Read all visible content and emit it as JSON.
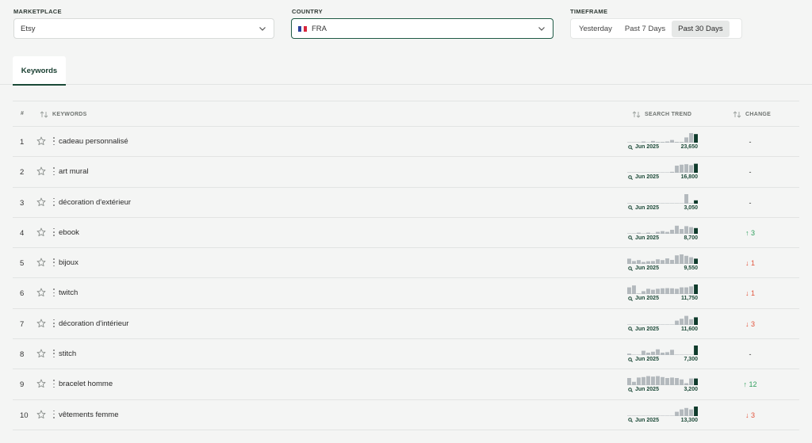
{
  "filters": {
    "marketplace_label": "MARKETPLACE",
    "marketplace_value": "Etsy",
    "country_label": "COUNTRY",
    "country_value": "FRA",
    "country_flag_colors": [
      "#2a3f9c",
      "#ffffff",
      "#d7263d"
    ],
    "timeframe_label": "TIMEFRAME",
    "timeframe_options": [
      "Yesterday",
      "Past 7 Days",
      "Past 30 Days"
    ],
    "timeframe_selected": "Past 30 Days"
  },
  "tabs": {
    "keywords": "Keywords"
  },
  "table": {
    "headers": {
      "num": "#",
      "keywords": "KEYWORDS",
      "search_trend": "SEARCH TREND",
      "change": "CHANGE"
    },
    "trend_month": "Jun 2025",
    "colors": {
      "bar": "#b3b9bd",
      "bar_last": "#0f3b2c",
      "baseline": "#c5c9cc"
    },
    "rows": [
      {
        "num": "1",
        "keyword": "cadeau personnalisé",
        "volume": "23,650",
        "change": "-",
        "direction": "none",
        "trend": [
          0.04,
          0.04,
          0.04,
          0.12,
          0.04,
          0.18,
          0.08,
          0.08,
          0.12,
          0.28,
          0.08,
          0.08,
          0.55,
          1.0,
          0.9
        ]
      },
      {
        "num": "2",
        "keyword": "art mural",
        "volume": "16,800",
        "change": "-",
        "direction": "none",
        "trend": [
          0.04,
          0.04,
          0.04,
          0.04,
          0.04,
          0.04,
          0.04,
          0.04,
          0.04,
          0.1,
          0.75,
          0.85,
          0.9,
          0.8,
          0.95
        ]
      },
      {
        "num": "3",
        "keyword": "décoration d'extérieur",
        "volume": "3,050",
        "change": "-",
        "direction": "none",
        "trend": [
          0.04,
          0.04,
          0.04,
          0.04,
          0.04,
          0.04,
          0.04,
          0.04,
          0.04,
          0.04,
          0.04,
          0.04,
          1.0,
          0.06,
          0.35
        ]
      },
      {
        "num": "4",
        "keyword": "ebook",
        "volume": "8,700",
        "change": "↑ 3",
        "direction": "up",
        "trend": [
          0.04,
          0.04,
          0.12,
          0.04,
          0.12,
          0.04,
          0.2,
          0.28,
          0.2,
          0.42,
          0.85,
          0.5,
          0.8,
          0.7,
          0.6
        ]
      },
      {
        "num": "5",
        "keyword": "bijoux",
        "volume": "9,550",
        "change": "↓ 1",
        "direction": "down",
        "trend": [
          0.55,
          0.3,
          0.4,
          0.2,
          0.28,
          0.3,
          0.48,
          0.4,
          0.58,
          0.42,
          0.9,
          1.0,
          0.85,
          0.7,
          0.55
        ]
      },
      {
        "num": "6",
        "keyword": "twitch",
        "volume": "11,750",
        "change": "↓ 1",
        "direction": "down",
        "trend": [
          0.7,
          0.9,
          0.06,
          0.3,
          0.55,
          0.45,
          0.55,
          0.6,
          0.62,
          0.6,
          0.55,
          0.7,
          0.7,
          0.8,
          1.0
        ]
      },
      {
        "num": "7",
        "keyword": "décoration d'intérieur",
        "volume": "11,600",
        "change": "↓ 3",
        "direction": "down",
        "trend": [
          0.04,
          0.04,
          0.04,
          0.04,
          0.04,
          0.04,
          0.04,
          0.04,
          0.04,
          0.04,
          0.45,
          0.65,
          0.95,
          0.6,
          0.8
        ]
      },
      {
        "num": "8",
        "keyword": "stitch",
        "volume": "7,300",
        "change": "-",
        "direction": "none",
        "trend": [
          0.15,
          0.04,
          0.04,
          0.45,
          0.25,
          0.35,
          0.6,
          0.25,
          0.3,
          0.55,
          0.04,
          0.04,
          0.04,
          0.04,
          1.0
        ]
      },
      {
        "num": "9",
        "keyword": "bracelet homme",
        "volume": "3,200",
        "change": "↑ 12",
        "direction": "up",
        "trend": [
          0.75,
          0.35,
          0.8,
          0.85,
          0.95,
          0.9,
          0.95,
          0.85,
          0.75,
          0.8,
          0.75,
          0.6,
          0.2,
          0.7,
          0.7
        ]
      },
      {
        "num": "10",
        "keyword": "vêtements femme",
        "volume": "13,300",
        "change": "↓ 3",
        "direction": "down",
        "trend": [
          0.04,
          0.04,
          0.04,
          0.04,
          0.04,
          0.04,
          0.04,
          0.04,
          0.04,
          0.04,
          0.45,
          0.7,
          0.85,
          0.7,
          1.0
        ]
      }
    ]
  }
}
